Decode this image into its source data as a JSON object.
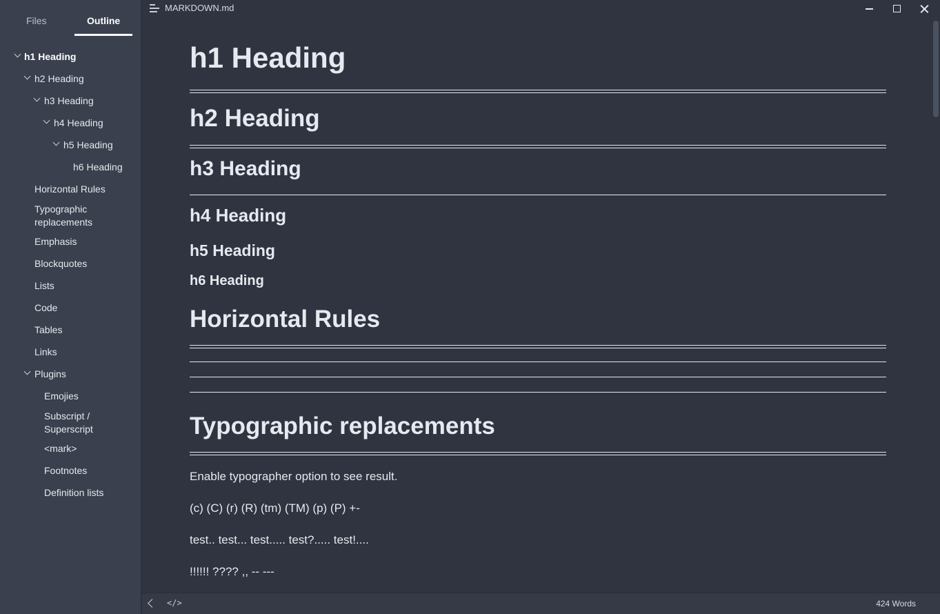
{
  "sidebar": {
    "tabs": [
      {
        "label": "Files"
      },
      {
        "label": "Outline"
      }
    ],
    "outline": [
      {
        "label": "h1 Heading"
      },
      {
        "label": "h2 Heading"
      },
      {
        "label": "h3 Heading"
      },
      {
        "label": "h4 Heading"
      },
      {
        "label": "h5 Heading"
      },
      {
        "label": "h6 Heading"
      },
      {
        "label": "Horizontal Rules"
      },
      {
        "label": "Typographic replacements"
      },
      {
        "label": "Emphasis"
      },
      {
        "label": "Blockquotes"
      },
      {
        "label": "Lists"
      },
      {
        "label": "Code"
      },
      {
        "label": "Tables"
      },
      {
        "label": "Links"
      },
      {
        "label": "Plugins"
      },
      {
        "label": "Emojies"
      },
      {
        "label": "Subscript / Superscript"
      },
      {
        "label": "<mark>"
      },
      {
        "label": "Footnotes"
      },
      {
        "label": "Definition lists"
      }
    ]
  },
  "titlebar": {
    "title": "MARKDOWN.md"
  },
  "document": {
    "h1": "h1 Heading",
    "h2": "h2 Heading",
    "h3": "h3 Heading",
    "h4": "h4 Heading",
    "h5": "h5 Heading",
    "h6": "h6 Heading",
    "horizontal_rules": "Horizontal Rules",
    "typographic": "Typographic replacements",
    "para1": "Enable typographer option to see result.",
    "para2": "(c) (C) (r) (R) (tm) (TM) (p) (P) +-",
    "para3": "test.. test... test..... test?..... test!....",
    "para4": "!!!!!! ???? ,,  -- ---"
  },
  "statusbar": {
    "code_icon": "</>",
    "word_count": "424 Words"
  }
}
